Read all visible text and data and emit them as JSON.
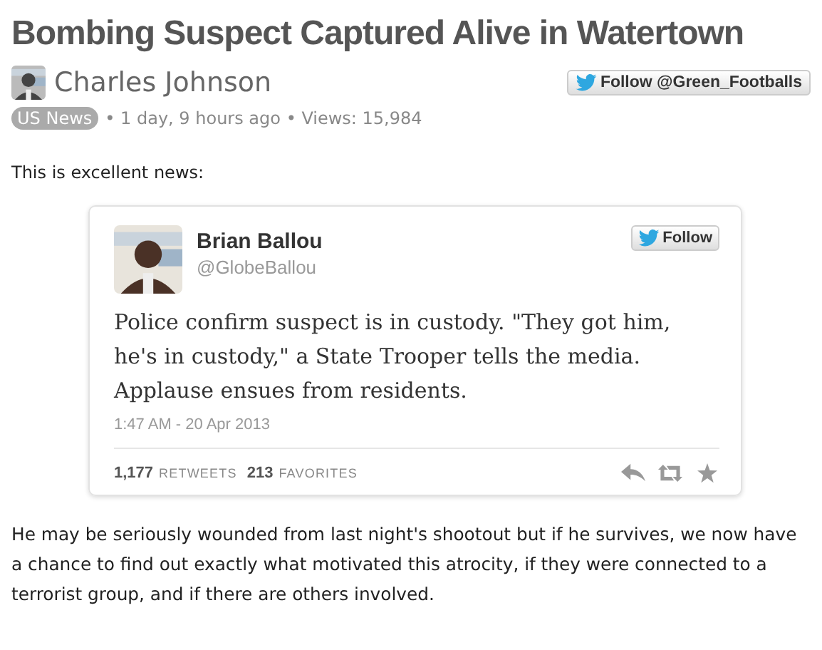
{
  "article": {
    "title": "Bombing Suspect Captured Alive in Watertown",
    "author": {
      "name": "Charles Johnson"
    },
    "follow_button": {
      "label": "Follow @Green_Footballs"
    },
    "category": "US News",
    "meta": "• 1 day, 9 hours ago • Views: 15,984",
    "paragraphs": [
      "This is excellent news:"
    ],
    "tweet": {
      "name": "Brian Ballou",
      "handle": "@GlobeBallou",
      "follow_button": {
        "label": "Follow"
      },
      "text": "Police confirm suspect is in custody. \"They got him, he's in custody,\" a State Trooper tells the media. Applause ensues from residents.",
      "timestamp": "1:47 AM - 20 Apr 2013",
      "stats": [
        {
          "count": "1,177",
          "label": "RETWEETS"
        },
        {
          "count": "213",
          "label": "FAVORITES"
        }
      ],
      "actions": [
        {
          "kind": "reply"
        },
        {
          "kind": "retweet"
        },
        {
          "kind": "favorite"
        }
      ]
    },
    "closing": "He may be seriously wounded from last night's shootout but if he survives, we now have a chance to find out exactly what motivated this atrocity, if they were connected to a terrorist group, and if there are others involved."
  }
}
